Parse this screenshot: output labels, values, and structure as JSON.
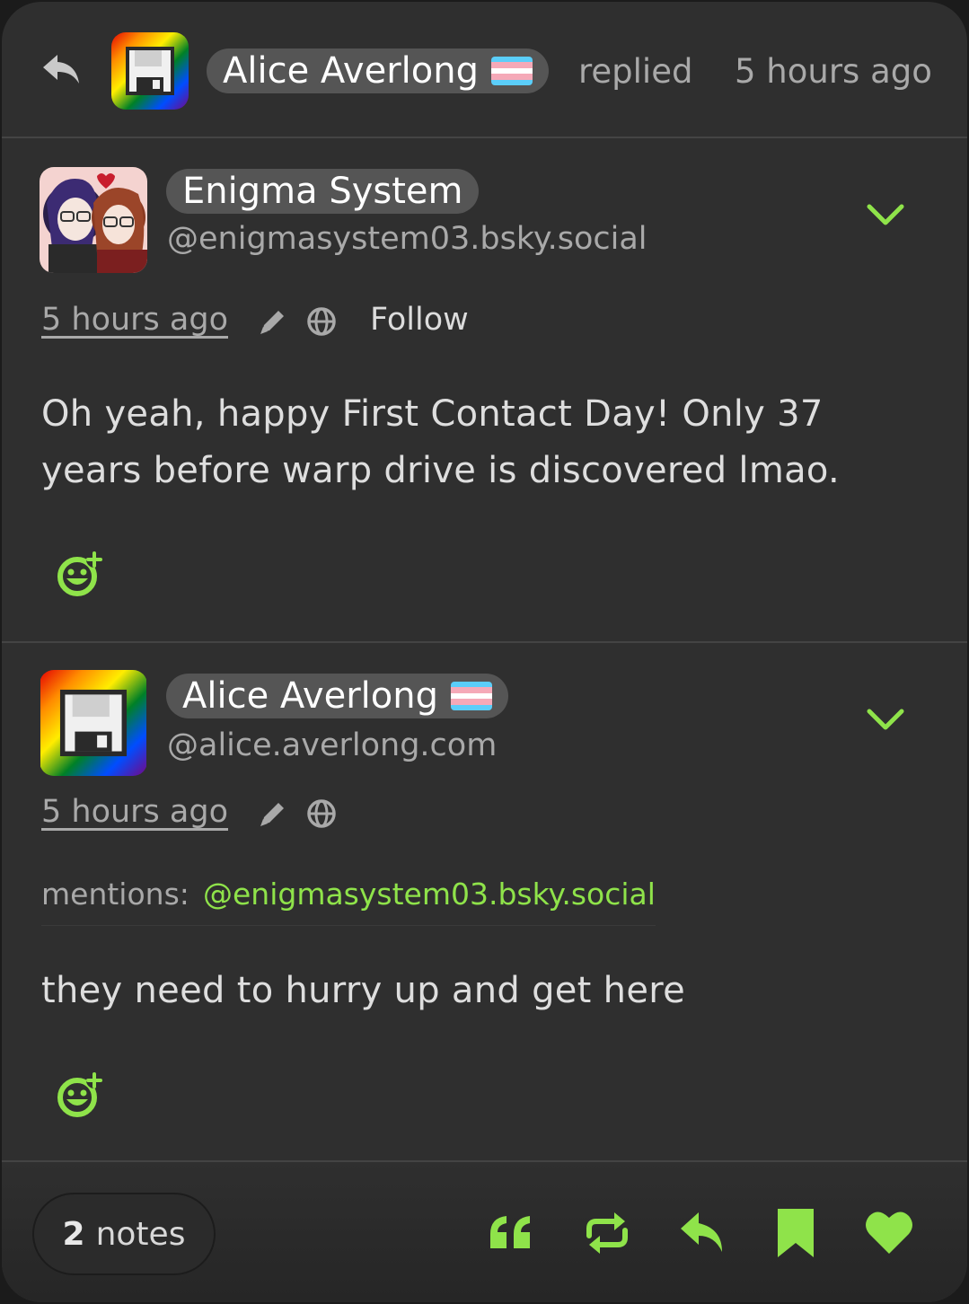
{
  "header": {
    "reply_icon": "reply-icon",
    "user_name": "Alice Averlong",
    "action_text": "replied",
    "time": "5 hours ago"
  },
  "posts": [
    {
      "name": "Enigma System",
      "handle": "@enigmasystem03.bsky.social",
      "time": "5 hours ago",
      "follow_label": "Follow",
      "body": "Oh yeah, happy First Contact Day! Only 37 years before warp drive is discovered lmao."
    },
    {
      "name": "Alice Averlong",
      "handle": "@alice.averlong.com",
      "time": "5 hours ago",
      "mentions_label": "mentions:",
      "mention": "@enigmasystem03.bsky.social",
      "body": "they need to hurry up and get here"
    }
  ],
  "footer": {
    "notes_count": "2",
    "notes_label": "notes"
  },
  "colors": {
    "accent": "#8fe34a",
    "background": "#2f2f2f",
    "pill": "#555555",
    "muted_text": "#a9a9a9"
  },
  "icons": [
    "reply-icon",
    "chevron-down-icon",
    "edit-icon",
    "globe-icon",
    "add-reaction-icon",
    "quote-icon",
    "repost-icon",
    "bookmark-icon",
    "heart-icon"
  ]
}
